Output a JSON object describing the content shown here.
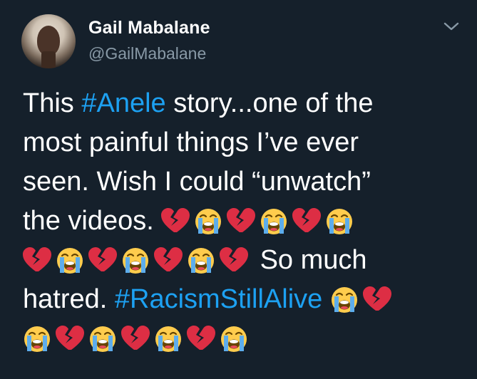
{
  "author": {
    "name": "Gail Mabalane",
    "handle": "@GailMabalane"
  },
  "icons": {
    "menu": "chevron-down-icon",
    "broken_heart": "broken-heart-icon",
    "crying_face": "loudly-crying-face-icon"
  },
  "colors": {
    "background": "#15202b",
    "hashtag": "#1da1f2",
    "secondary_text": "#8899a6",
    "broken_heart": "#dd2e44",
    "emoji_face": "#ffcc4d",
    "emoji_tears": "#5dadec"
  },
  "tweet": {
    "line1": {
      "pre": "This ",
      "hashtag": "#Anele",
      "post": " story...one of the"
    },
    "line2": "most painful things I’ve ever",
    "line3": "seen. Wish I could “unwatch”",
    "line4": "the videos.",
    "line5_text": "So much",
    "line6": {
      "pre": "hatred. ",
      "hashtag": "#RacismStillAlive"
    }
  }
}
